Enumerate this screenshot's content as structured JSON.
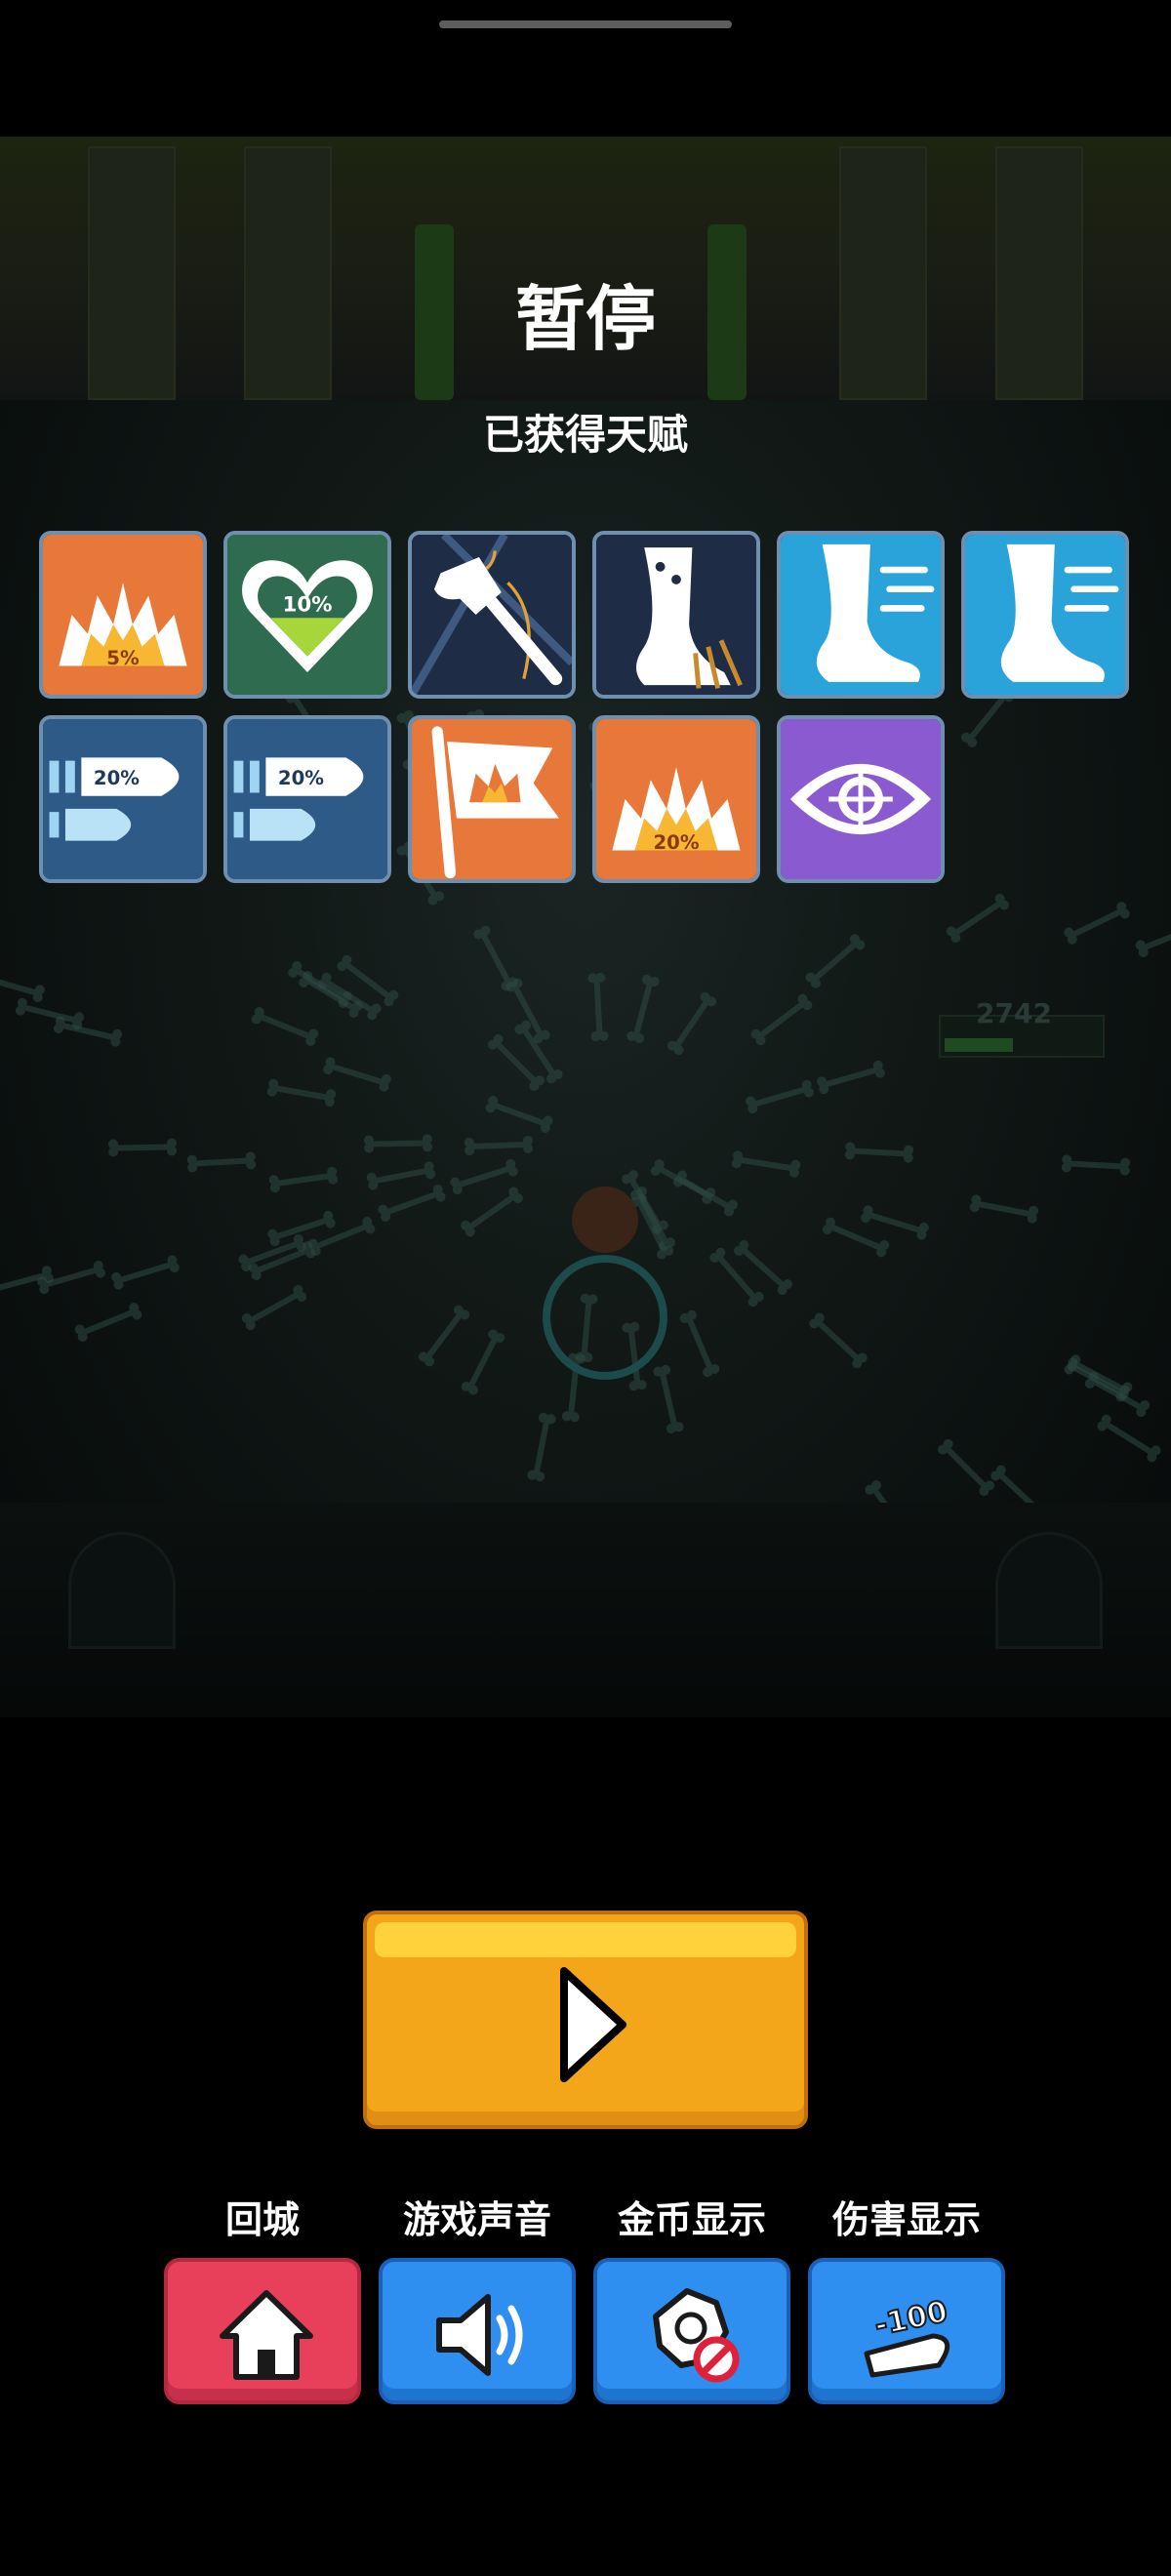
{
  "pause_menu": {
    "title": "暂停",
    "subtitle": "已获得天赋"
  },
  "background": {
    "enemy_hp_text": "2742"
  },
  "talents": [
    {
      "icon": "explosion-icon",
      "badge": "5%",
      "color": "#e8783a"
    },
    {
      "icon": "heart-heal-icon",
      "badge": "10%",
      "color": "#2e6b4f"
    },
    {
      "icon": "axe-icon",
      "badge": "",
      "color": "#1e2c45"
    },
    {
      "icon": "bone-foot-icon",
      "badge": "",
      "color": "#1e2c45"
    },
    {
      "icon": "fast-foot-icon",
      "badge": "",
      "color": "#2aa3db"
    },
    {
      "icon": "fast-foot-icon",
      "badge": "",
      "color": "#2aa3db"
    },
    {
      "icon": "bullet-icon",
      "badge": "20%",
      "color": "#2e5a87"
    },
    {
      "icon": "bullet-icon",
      "badge": "20%",
      "color": "#2e5a87"
    },
    {
      "icon": "explosion-flag-icon",
      "badge": "",
      "color": "#e8783a"
    },
    {
      "icon": "explosion-icon",
      "badge": "20%",
      "color": "#e8783a"
    },
    {
      "icon": "target-eye-icon",
      "badge": "",
      "color": "#8a5ad0"
    }
  ],
  "play_button": {
    "icon": "play-icon",
    "color": "#f4a61a"
  },
  "controls": [
    {
      "label": "回城",
      "icon": "home-icon",
      "color": "#e8405a"
    },
    {
      "label": "游戏声音",
      "icon": "speaker-icon",
      "color": "#2e8ff0"
    },
    {
      "label": "金币显示",
      "icon": "coin-hidden-icon",
      "color": "#2e8ff0"
    },
    {
      "label": "伤害显示",
      "icon": "damage-number-icon",
      "badge": "-100",
      "color": "#2e8ff0"
    }
  ]
}
